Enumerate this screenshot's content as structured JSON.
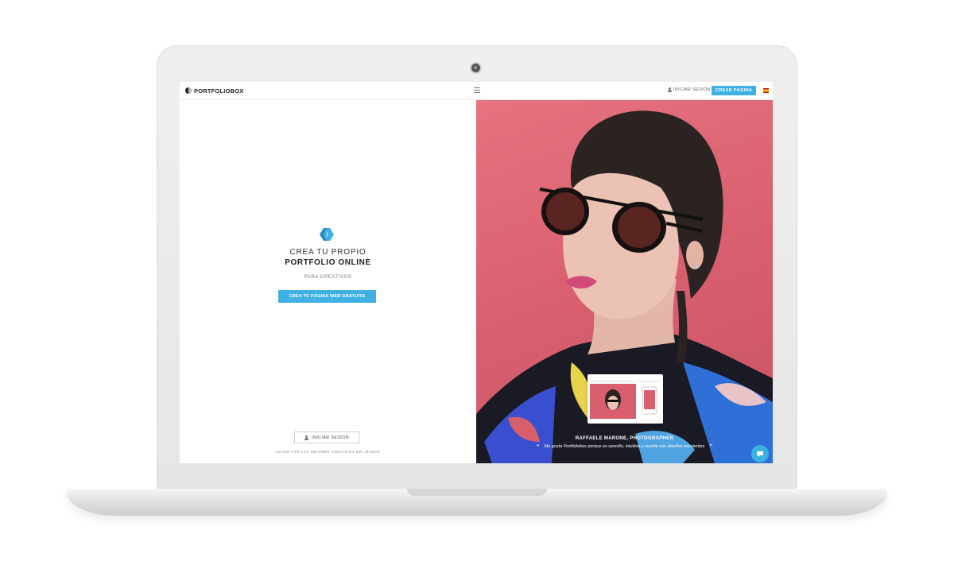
{
  "header": {
    "logo_text": "PORTFOLIOBOX",
    "login_label": "INICIAR SESIÓN",
    "create_label": "CREAR PÁGINA",
    "language": "es"
  },
  "hero": {
    "title_line1": "CREA TU PROPIO",
    "title_line2": "PORTFOLIO ONLINE",
    "subtitle": "PARA CREATIVOS",
    "cta_label": "CREA TU PÁGINA WEB GRATUITA"
  },
  "footer": {
    "login_label": "INICIAR SESIÓN",
    "used_by": "USADO POR LOS MEJORES CREATIVOS DEL MUNDO"
  },
  "testimonial": {
    "author": "RAFFAELE MARONE, PHOTOGRAPHER",
    "quote": "Me gusta Portfoliobox porque es sencillo, intuitivo y cuenta con diseños excelentes"
  },
  "colors": {
    "accent": "#3eb0e3",
    "photo_bg": "#d95f6f"
  },
  "icons": {
    "hero": "portfoliobox-logo-icon",
    "menu": "hamburger-menu-icon",
    "user": "user-icon",
    "chat": "chat-icon"
  }
}
